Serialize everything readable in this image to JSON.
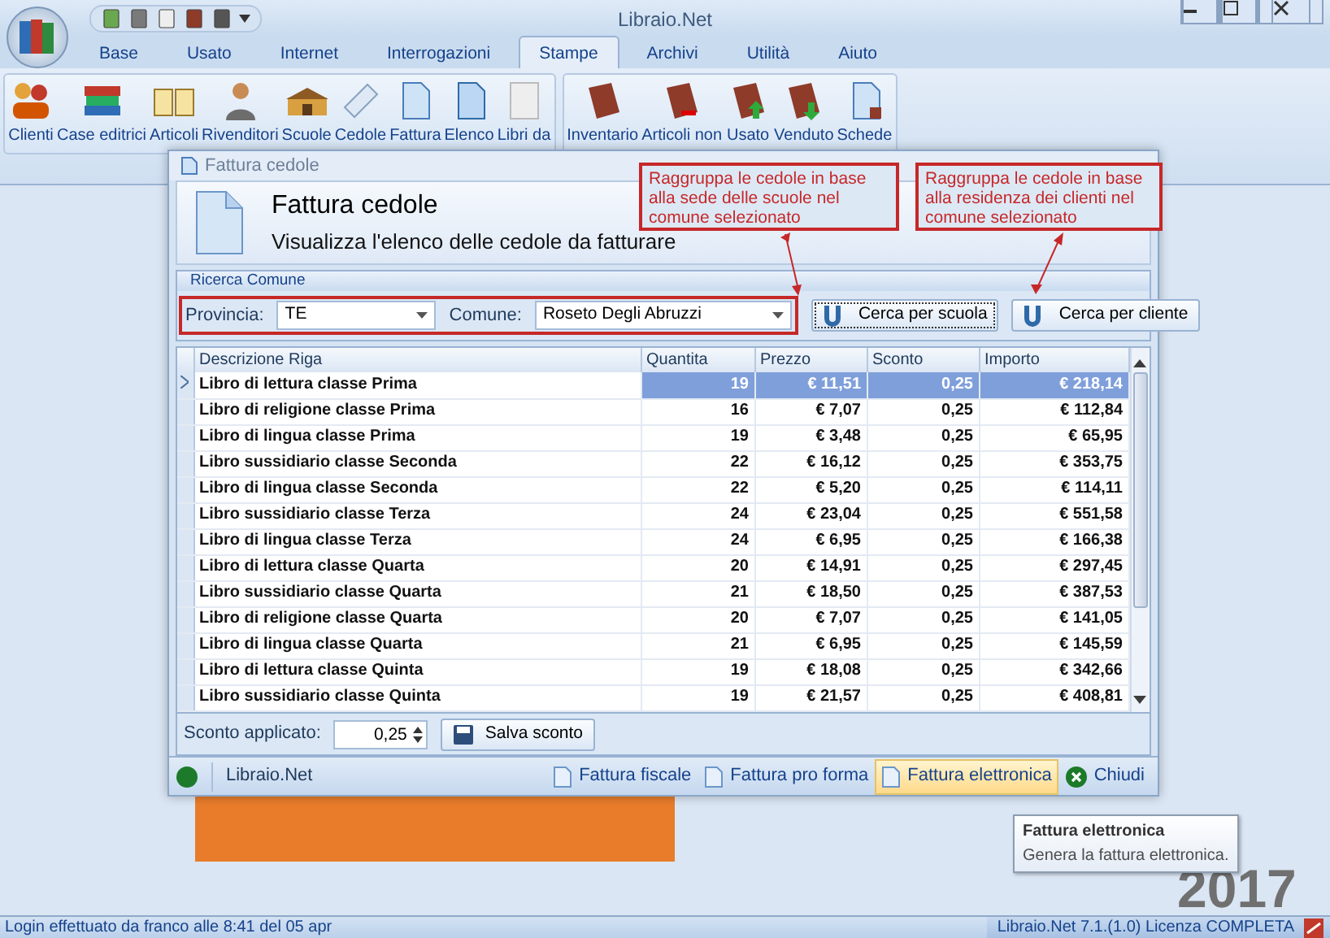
{
  "app": {
    "title": "Libraio.Net"
  },
  "ribbon_tabs": [
    {
      "label": "Base",
      "selected": false
    },
    {
      "label": "Usato",
      "selected": false
    },
    {
      "label": "Internet",
      "selected": false
    },
    {
      "label": "Interrogazioni",
      "selected": false
    },
    {
      "label": "Stampe",
      "selected": true
    },
    {
      "label": "Archivi",
      "selected": false
    },
    {
      "label": "Utilità",
      "selected": false
    },
    {
      "label": "Aiuto",
      "selected": false
    }
  ],
  "ribbon_groups": [
    {
      "buttons": [
        "Clienti",
        "Case editrici",
        "Articoli",
        "Rivenditori",
        "Scuole",
        "Cedole",
        "Fattura",
        "Elenco",
        "Libri da"
      ]
    },
    {
      "buttons": [
        "Inventario",
        "Articoli non",
        "Usato",
        "Venduto",
        "Schede"
      ]
    }
  ],
  "dialog": {
    "title": "Fattura cedole",
    "heading": "Fattura cedole",
    "subtitle": "Visualizza l'elenco delle cedole da fatturare",
    "search_group": {
      "title": "Ricerca Comune",
      "provincia_label": "Provincia:",
      "provincia_value": "TE",
      "comune_label": "Comune:",
      "comune_value": "Roseto Degli Abruzzi",
      "buttons": [
        {
          "label": "Cerca per scuola",
          "focused": true
        },
        {
          "label": "Cerca per cliente",
          "focused": false
        }
      ]
    },
    "table": {
      "columns": [
        "Descrizione Riga",
        "Quantita",
        "Prezzo",
        "Sconto",
        "Importo"
      ],
      "rows": [
        {
          "cells": [
            "Libro di lettura classe Prima",
            "19",
            "€ 11,51",
            "0,25",
            "€ 218,14"
          ],
          "selected": true
        },
        {
          "cells": [
            "Libro di religione classe Prima",
            "16",
            "€ 7,07",
            "0,25",
            "€ 112,84"
          ],
          "selected": false
        },
        {
          "cells": [
            "Libro di lingua classe Prima",
            "19",
            "€ 3,48",
            "0,25",
            "€ 65,95"
          ],
          "selected": false
        },
        {
          "cells": [
            "Libro sussidiario classe Seconda",
            "22",
            "€ 16,12",
            "0,25",
            "€ 353,75"
          ],
          "selected": false
        },
        {
          "cells": [
            "Libro di lingua classe Seconda",
            "22",
            "€ 5,20",
            "0,25",
            "€ 114,11"
          ],
          "selected": false
        },
        {
          "cells": [
            "Libro sussidiario classe Terza",
            "24",
            "€ 23,04",
            "0,25",
            "€ 551,58"
          ],
          "selected": false
        },
        {
          "cells": [
            "Libro di lingua classe Terza",
            "24",
            "€ 6,95",
            "0,25",
            "€ 166,38"
          ],
          "selected": false
        },
        {
          "cells": [
            "Libro di lettura classe Quarta",
            "20",
            "€ 14,91",
            "0,25",
            "€ 297,45"
          ],
          "selected": false
        },
        {
          "cells": [
            "Libro sussidiario classe Quarta",
            "21",
            "€ 18,50",
            "0,25",
            "€ 387,53"
          ],
          "selected": false
        },
        {
          "cells": [
            "Libro di religione classe Quarta",
            "20",
            "€ 7,07",
            "0,25",
            "€ 141,05"
          ],
          "selected": false
        },
        {
          "cells": [
            "Libro di lingua classe Quarta",
            "21",
            "€ 6,95",
            "0,25",
            "€ 145,59"
          ],
          "selected": false
        },
        {
          "cells": [
            "Libro di lettura classe Quinta",
            "19",
            "€ 18,08",
            "0,25",
            "€ 342,66"
          ],
          "selected": false
        },
        {
          "cells": [
            "Libro sussidiario classe Quinta",
            "19",
            "€ 21,57",
            "0,25",
            "€ 408,81"
          ],
          "selected": false
        }
      ]
    },
    "discount": {
      "label": "Sconto applicato:",
      "value": "0,25",
      "button": "Salva sconto"
    },
    "footer": {
      "app_label": "Libraio.Net",
      "actions": [
        {
          "label": "Fattura fiscale",
          "highlighted": false
        },
        {
          "label": "Fattura pro forma",
          "highlighted": false
        },
        {
          "label": "Fattura elettronica",
          "highlighted": true
        },
        {
          "label": "Chiudi",
          "highlighted": false
        }
      ]
    }
  },
  "callouts": [
    {
      "text": "Raggruppa le cedole in base alla sede delle scuole nel comune selezionato"
    },
    {
      "text": "Raggruppa le cedole in base alla residenza dei clienti nel comune selezionato"
    }
  ],
  "tooltip": {
    "title": "Fattura elettronica",
    "text": "Genera la fattura elettronica."
  },
  "year": "2017",
  "status_bar": {
    "left": "Login effettuato da franco alle 8:41 del 05 apr",
    "right": "Libraio.Net 7.1.(1.0) Licenza COMPLETA"
  }
}
